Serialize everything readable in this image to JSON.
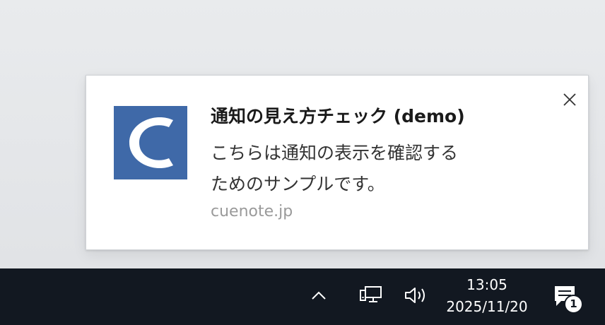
{
  "notification": {
    "title": "通知の見え方チェック (demo)",
    "body_line1": "こちらは通知の表示を確認する",
    "body_line2": "ためのサンプルです。",
    "source": "cuenote.jp",
    "app_icon": "cuenote-c-logo",
    "app_icon_color": "#3f69a8",
    "close_icon": "close-icon"
  },
  "taskbar": {
    "background": "#121821",
    "tray_icons": [
      "chevron-up-icon",
      "network-icon",
      "volume-icon"
    ],
    "time": "13:05",
    "date": "2025/11/20",
    "action_center_icon": "action-center-icon",
    "notification_count": "1"
  }
}
